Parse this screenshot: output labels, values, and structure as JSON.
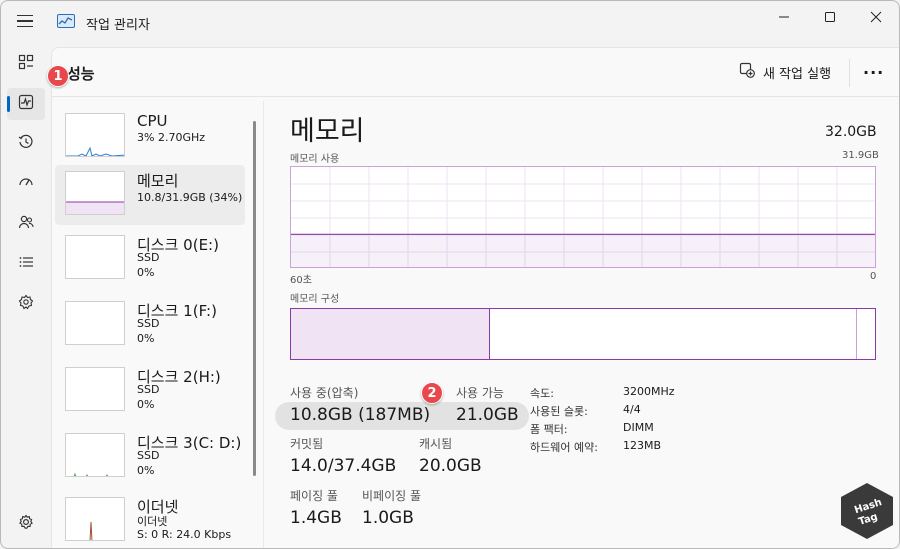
{
  "window": {
    "title": "작업 관리자",
    "controls": {
      "minimize": "minimize-icon",
      "maximize": "maximize-icon",
      "close": "close-icon"
    }
  },
  "nav": {
    "items": [
      {
        "name": "processes",
        "icon": "processes-icon"
      },
      {
        "name": "performance",
        "icon": "performance-icon",
        "active": true
      },
      {
        "name": "app-history",
        "icon": "history-icon"
      },
      {
        "name": "startup-apps",
        "icon": "startup-icon"
      },
      {
        "name": "users",
        "icon": "users-icon"
      },
      {
        "name": "details",
        "icon": "details-icon"
      },
      {
        "name": "services",
        "icon": "services-icon"
      }
    ],
    "settings_icon": "settings-icon"
  },
  "header": {
    "title": "성능",
    "new_task_label": "새 작업 실행",
    "more_label": "···"
  },
  "badges": {
    "one": "1",
    "two": "2"
  },
  "devices": [
    {
      "name": "CPU",
      "line1": "3% 2.70GHz",
      "line2": ""
    },
    {
      "name": "메모리",
      "line1": "10.8/31.9GB (34%)",
      "line2": ""
    },
    {
      "name": "디스크 0(E:)",
      "line1": "SSD",
      "line2": "0%"
    },
    {
      "name": "디스크 1(F:)",
      "line1": "SSD",
      "line2": "0%"
    },
    {
      "name": "디스크 2(H:)",
      "line1": "SSD",
      "line2": "0%"
    },
    {
      "name": "디스크 3(C: D:)",
      "line1": "SSD",
      "line2": "0%"
    },
    {
      "name": "이더넷",
      "line1": "이더넷",
      "line2": "S: 0 R: 24.0 Kbps"
    }
  ],
  "detail": {
    "title": "메모리",
    "total": "32.0GB",
    "usage_label": "메모리 사용",
    "usage_max": "31.9GB",
    "time_left": "60초",
    "time_right": "0",
    "usage_fraction": 0.34,
    "composition_label": "메모리 구성",
    "in_use_fraction": 0.34,
    "stats": {
      "in_use_label": "사용 중(압축)",
      "in_use_value": "10.8GB (187MB)",
      "available_label": "사용 가능",
      "available_value": "21.0GB",
      "committed_label": "커밋됨",
      "committed_value": "14.0/37.4GB",
      "cached_label": "캐시됨",
      "cached_value": "20.0GB",
      "paged_label": "페이징 풀",
      "paged_value": "1.4GB",
      "nonpaged_label": "비페이징 풀",
      "nonpaged_value": "1.0GB"
    },
    "specs": [
      {
        "key": "속도:",
        "value": "3200MHz"
      },
      {
        "key": "사용된 슬롯:",
        "value": "4/4"
      },
      {
        "key": "폼 팩터:",
        "value": "DIMM"
      },
      {
        "key": "하드웨어 예약:",
        "value": "123MB"
      }
    ]
  },
  "colors": {
    "memory": "#8a3aa6",
    "cpu": "#2b7cd3",
    "ethernet": "#a0522d",
    "badge": "#e8474c"
  },
  "watermark_text": "Hash Tag"
}
